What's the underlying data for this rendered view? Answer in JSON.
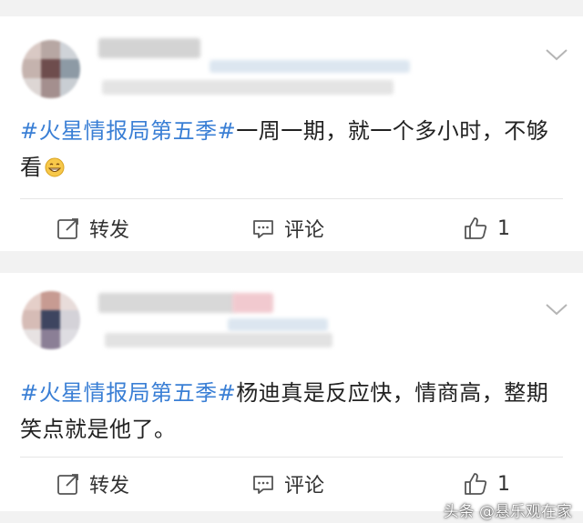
{
  "posts": [
    {
      "hashtag": "#火星情报局第五季#",
      "body": "一周一期，就一个多小时，不够看",
      "emoji_icon": "grinning-face-icon",
      "actions": {
        "repost": "转发",
        "comment": "评论",
        "like_count": "1"
      }
    },
    {
      "hashtag": "#火星情报局第五季#",
      "body": "杨迪真是反应快，情商高，整期笑点就是他了。",
      "actions": {
        "repost": "转发",
        "comment": "评论",
        "like_count": "1"
      }
    }
  ],
  "watermark": "头条 @悬乐观在家",
  "colors": {
    "hashtag": "#3a7fd5",
    "text": "#222222",
    "background": "#f2f2f2"
  }
}
